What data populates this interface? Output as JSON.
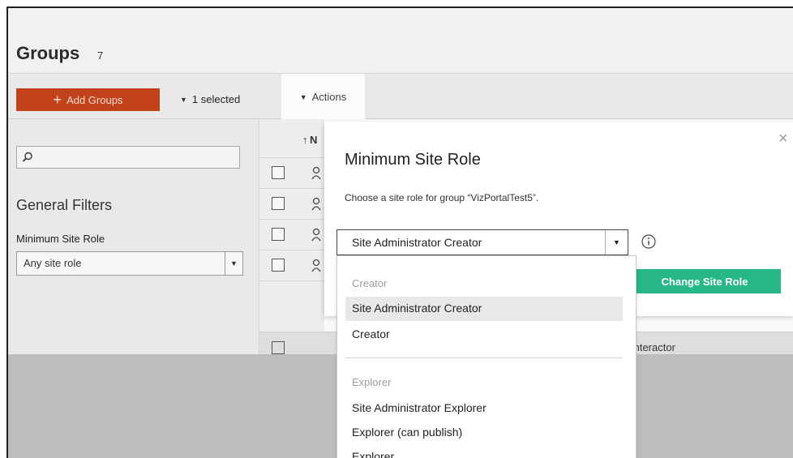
{
  "header": {
    "title": "Groups",
    "count": "7"
  },
  "toolbar": {
    "add_label": "Add Groups",
    "add_icon": "plus-icon",
    "selected_label": "1 selected",
    "actions_label": "Actions"
  },
  "filters": {
    "search_placeholder": "",
    "section_title": "General Filters",
    "role_label": "Minimum Site Role",
    "role_value": "Any site role"
  },
  "table": {
    "sort_label": "N",
    "rows": 4
  },
  "background_row": {
    "role_text": "Interactor"
  },
  "modal": {
    "title": "Minimum Site Role",
    "description": "Choose a site role for group “VizPortalTest5”.",
    "select_value": "Site Administrator Creator",
    "submit_label": "Change Site Role",
    "close_symbol": "×"
  },
  "dropdown": {
    "groups": [
      {
        "label": "Creator",
        "items": [
          "Site Administrator Creator",
          "Creator"
        ]
      },
      {
        "label": "Explorer",
        "items": [
          "Site Administrator Explorer",
          "Explorer (can publish)",
          "Explorer"
        ]
      }
    ],
    "selected_item": "Site Administrator Creator"
  },
  "colors": {
    "add_button": "#c1411a",
    "change_button": "#27b985",
    "selected_item_bg": "#e8e8e8"
  }
}
